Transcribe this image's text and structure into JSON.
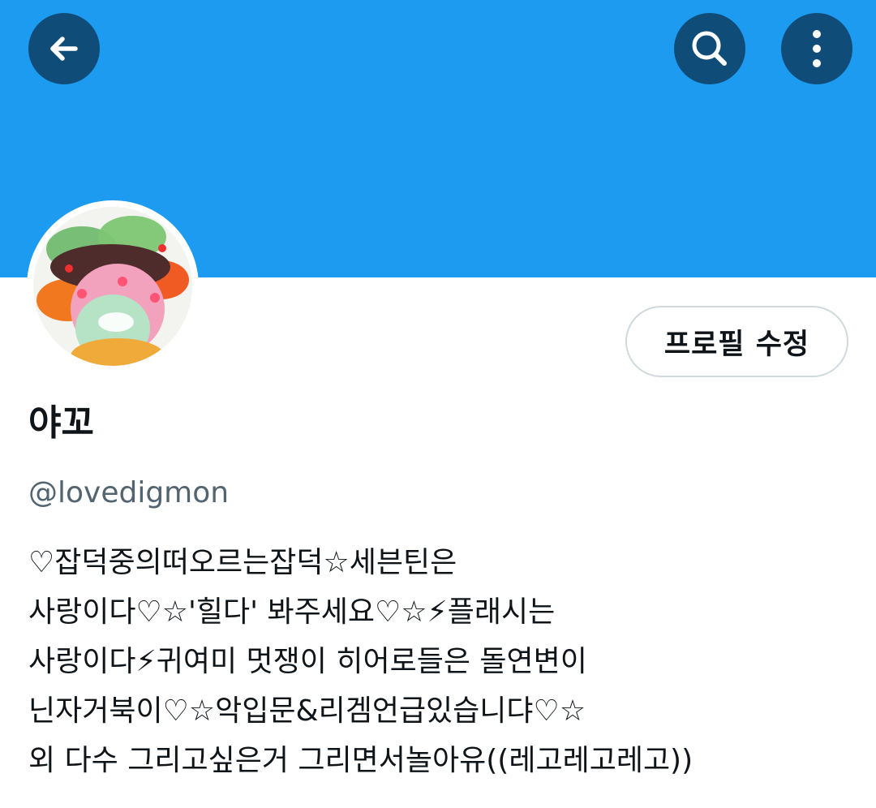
{
  "header": {
    "back_icon": "arrow-left-icon",
    "search_icon": "search-icon",
    "more_icon": "more-vertical-icon"
  },
  "profile": {
    "display_name": "야꼬",
    "handle": "@lovedigmon",
    "edit_profile_label": "프로필 수정"
  },
  "bio": {
    "lines": [
      "♡잡덕중의떠오르는잡덕☆세븐틴은",
      "사랑이다♡☆'힐다' 봐주세요♡☆⚡플래시는",
      "사랑이다⚡귀여미 멋쟁이 히어로들은 돌연변이",
      "닌자거북이♡☆악입문&리겜언급있습니댜♡☆",
      "외 다수 그리고싶은거 그리면서놀아유((레고레고레고))"
    ]
  },
  "colors": {
    "banner": "#1d9bf0",
    "header_button_bg": "#0f4c78",
    "primary_text": "#0f1419",
    "secondary_text": "#536471",
    "button_border": "#cfd9de",
    "lightning": "#f6c64a"
  }
}
